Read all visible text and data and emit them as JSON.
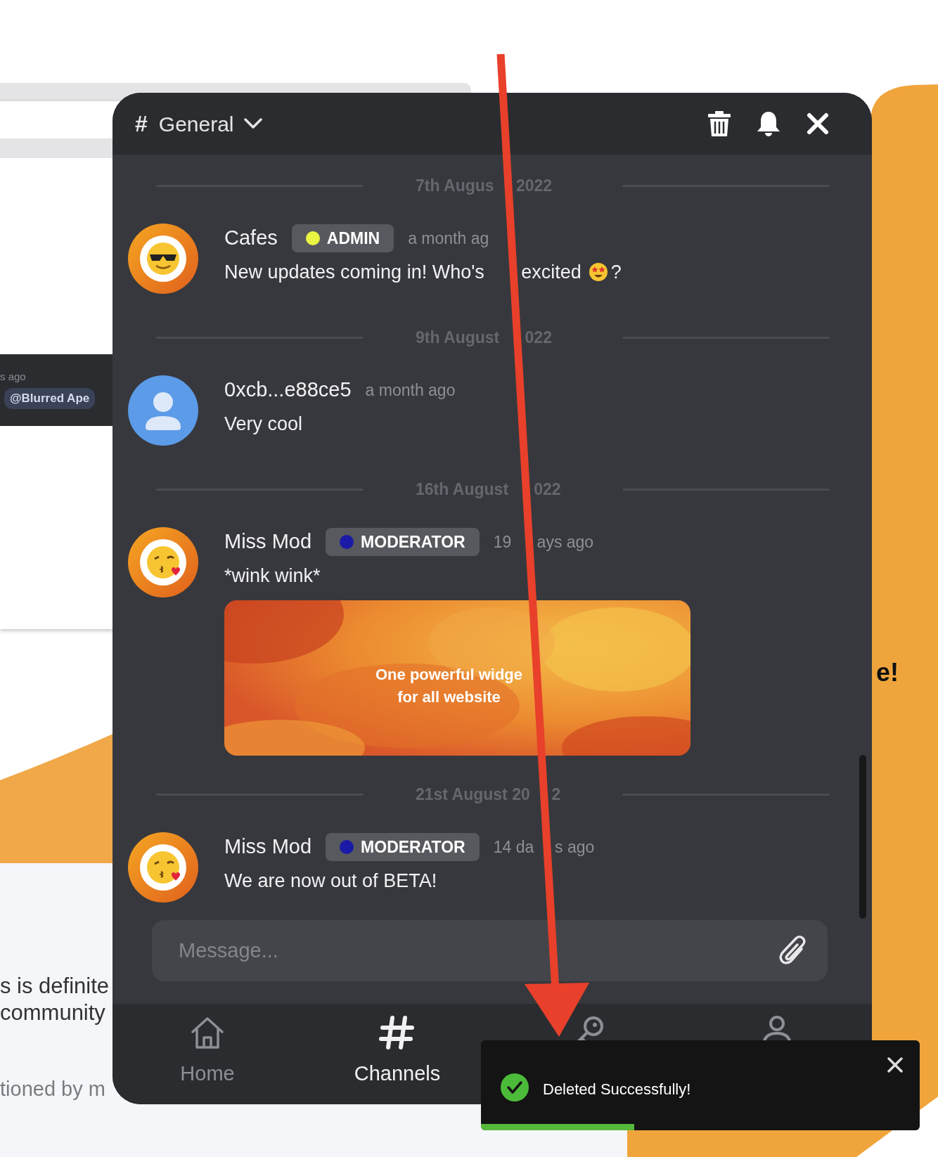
{
  "background": {
    "snippets": [
      {
        "kind": "time",
        "text": "s ago"
      },
      {
        "kind": "mention",
        "text": "@Blurred Ape"
      },
      {
        "kind": "heading",
        "text": "e!"
      },
      {
        "kind": "body",
        "text": "s is definite"
      },
      {
        "kind": "body",
        "text": "community"
      },
      {
        "kind": "muted",
        "text": "tioned by m"
      }
    ]
  },
  "channel": {
    "hash": "#",
    "name": "General"
  },
  "messages": [
    {
      "date": [
        "7th Augus",
        "2022"
      ],
      "author": "Cafes",
      "avatar": {
        "kind": "sunglasses"
      },
      "role": {
        "label": "ADMIN",
        "color": "#e9f542"
      },
      "time": [
        "a month ag"
      ],
      "text": [
        "New updates coming in! Who's",
        "excited"
      ],
      "emoji": true,
      "text_after": "?"
    },
    {
      "date": [
        "9th August",
        "022"
      ],
      "author": "0xcb...e88ce5",
      "avatar": {
        "kind": "person"
      },
      "time": [
        "a month ago"
      ],
      "text": [
        "Very cool"
      ]
    },
    {
      "date": [
        "16th August",
        "022"
      ],
      "author": "Miss Mod",
      "avatar": {
        "kind": "kiss"
      },
      "role": {
        "label": "MODERATOR",
        "color": "#1a1aa6"
      },
      "time": [
        "19",
        "ays ago"
      ],
      "text": [
        "*wink wink*"
      ],
      "attachment": {
        "kind": "picture",
        "caption": [
          "One powerful widge",
          "for all website"
        ]
      }
    },
    {
      "date": [
        "21st August 20",
        "2"
      ],
      "author": "Miss Mod",
      "avatar": {
        "kind": "kiss"
      },
      "role": {
        "label": "MODERATOR",
        "color": "#1a1aa6"
      },
      "time": [
        "14 da",
        "s ago"
      ],
      "text": [
        "We are now out of BETA!"
      ]
    }
  ],
  "composer": {
    "placeholder": "Message..."
  },
  "nav": [
    {
      "kind": "home",
      "label": "Home",
      "selected": false
    },
    {
      "kind": "hash",
      "label": "Channels",
      "selected": true
    },
    {
      "kind": "key",
      "selected": false
    },
    {
      "kind": "person",
      "selected": false
    }
  ],
  "toast": {
    "message": "Deleted Successfully!",
    "level": 0.35
  }
}
